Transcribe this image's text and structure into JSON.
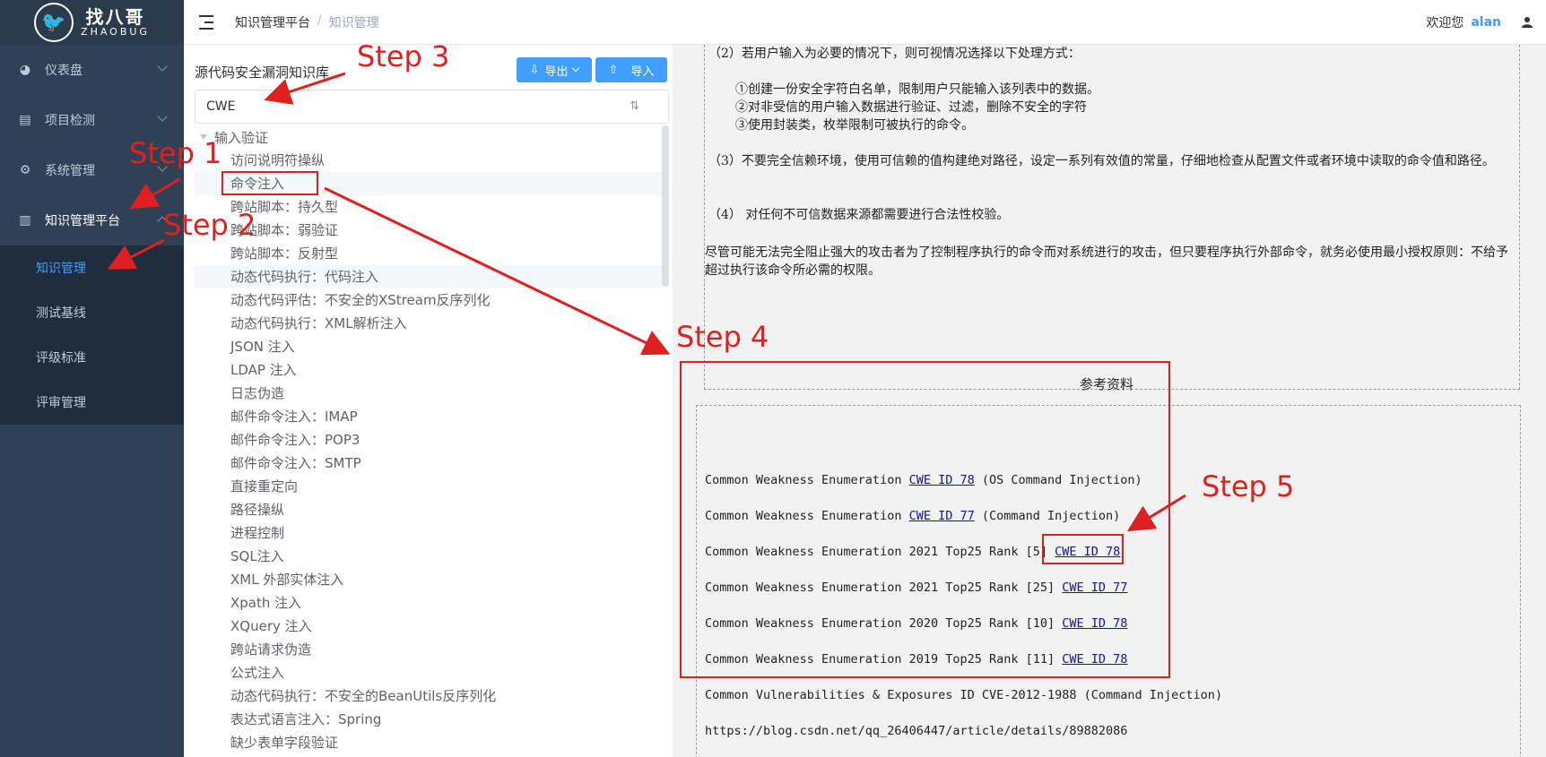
{
  "app": {
    "logo_cn": "找八哥",
    "logo_en": "ZHAOBUG"
  },
  "sidebar": {
    "items": [
      {
        "label": "仪表盘",
        "icon": "dashboard-icon"
      },
      {
        "label": "项目检测",
        "icon": "clipboard-icon"
      },
      {
        "label": "系统管理",
        "icon": "gear-icon"
      },
      {
        "label": "知识管理平台",
        "icon": "book-icon"
      }
    ],
    "submenu": [
      "知识管理",
      "测试基线",
      "评级标准",
      "评审管理"
    ],
    "active_submenu": "知识管理"
  },
  "topbar": {
    "breadcrumb": [
      "知识管理平台",
      "知识管理"
    ],
    "welcome": "欢迎您",
    "username": "alan"
  },
  "left_panel": {
    "title": "源代码安全漏洞知识库",
    "export_label": "导出",
    "import_label": "导入",
    "search_value": "CWE",
    "tree_root": "输入验证",
    "tree_items": [
      "访问说明符操纵",
      "命令注入",
      "跨站脚本：持久型",
      "跨站脚本：弱验证",
      "跨站脚本：反射型",
      "动态代码执行：代码注入",
      "动态代码评估：不安全的XStream反序列化",
      "动态代码执行：XML解析注入",
      "JSON 注入",
      "LDAP 注入",
      "日志伪造",
      "邮件命令注入：IMAP",
      "邮件命令注入：POP3",
      "邮件命令注入：SMTP",
      "直接重定向",
      "路径操纵",
      "进程控制",
      "SQL注入",
      "XML 外部实体注入",
      "Xpath 注入",
      "XQuery 注入",
      "跨站请求伪造",
      "公式注入",
      "动态代码执行：不安全的BeanUtils反序列化",
      "表达式语言注入：Spring",
      "缺少表单字段验证"
    ]
  },
  "content": {
    "p2": "（2）若用户输入为必要的情况下，则可视情况选择以下处理方式：",
    "p2_items": [
      "①创建一份安全字符白名单，限制用户只能输入该列表中的数据。",
      "②对非受信的用户输入数据进行验证、过滤，删除不安全的字符",
      "③使用封装类，枚举限制可被执行的命令。"
    ],
    "p3": "（3）不要完全信赖环境，使用可信赖的值构建绝对路径，设定一系列有效值的常量，仔细地检查从配置文件或者环境中读取的命令值和路径。",
    "p4": "（4） 对任何不可信数据来源都需要进行合法性校验。",
    "p5": "尽管可能无法完全阻止强大的攻击者为了控制程序执行的命令而对系统进行的攻击，但只要程序执行外部命令，就务必使用最小授权原则：不给予超过执行该命令所必需的权限。",
    "ref_heading": "参考资料",
    "refs": [
      {
        "pre": "Common Weakness Enumeration ",
        "link": "CWE ID 78",
        "post": " (OS Command Injection)"
      },
      {
        "pre": "Common Weakness Enumeration ",
        "link": "CWE ID 77",
        "post": " (Command Injection)"
      },
      {
        "pre": "Common Weakness Enumeration 2021 Top25 Rank [5] ",
        "link": "CWE ID 78",
        "post": ""
      },
      {
        "pre": "Common Weakness Enumeration 2021 Top25 Rank [25] ",
        "link": "CWE ID 77",
        "post": ""
      },
      {
        "pre": "Common Weakness Enumeration 2020 Top25 Rank [10] ",
        "link": "CWE ID 78",
        "post": ""
      },
      {
        "pre": "Common Weakness Enumeration 2019 Top25 Rank [11] ",
        "link": "CWE ID 78",
        "post": ""
      },
      {
        "pre": "Common Vulnerabilities & Exposures ID CVE-2012-1988 (Command Injection)",
        "link": "",
        "post": ""
      },
      {
        "pre": "https://blog.csdn.net/qq_26406447/article/details/89882086",
        "link": "",
        "post": ""
      }
    ]
  },
  "annotations": {
    "steps": [
      "Step 1",
      "Step 2",
      "Step 3",
      "Step 4",
      "Step 5"
    ],
    "color": "#e02020"
  }
}
